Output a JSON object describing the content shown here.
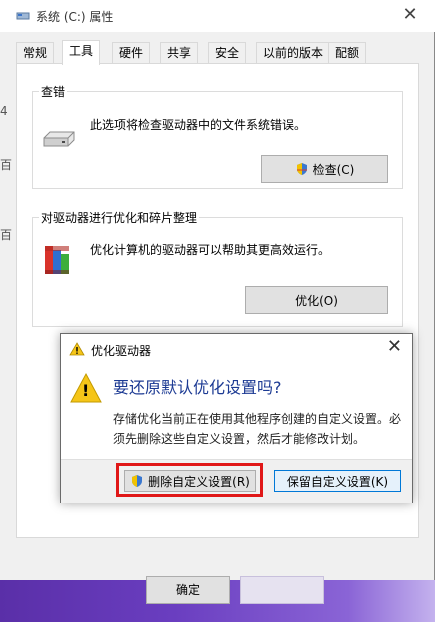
{
  "window": {
    "title": "系统 (C:) 属性",
    "close_glyph": "✕"
  },
  "tabs": [
    {
      "label": "常规",
      "active": false
    },
    {
      "label": "工具",
      "active": true
    },
    {
      "label": "硬件",
      "active": false
    },
    {
      "label": "共享",
      "active": false
    },
    {
      "label": "安全",
      "active": false
    },
    {
      "label": "以前的版本",
      "active": false
    },
    {
      "label": "配额",
      "active": false
    }
  ],
  "check_group": {
    "title": "查错",
    "description": "此选项将检查驱动器中的文件系统错误。",
    "button_label": "检查(C)"
  },
  "optimize_group": {
    "title": "对驱动器进行优化和碎片整理",
    "description": "优化计算机的驱动器可以帮助其更高效运行。",
    "button_label": "优化(O)"
  },
  "bottom_buttons": {
    "ok_label": "确定",
    "cancel_label": ""
  },
  "background_fragments": [
    "4",
    "百",
    "百"
  ],
  "dialog": {
    "title": "优化驱动器",
    "close_glyph": "✕",
    "heading": "要还原默认优化设置吗?",
    "message": "存储优化当前正在使用其他程序创建的自定义设置。必须先删除这些自定义设置，然后才能修改计划。",
    "delete_button_label": "删除自定义设置(R)",
    "keep_button_label": "保留自定义设置(K)",
    "warning_glyph": "!"
  },
  "colors": {
    "highlight": "#e01717",
    "dialog_heading": "#1c3a93",
    "warning_yellow": "#f5c518",
    "taskbar_purple": "#6a3ec0"
  }
}
